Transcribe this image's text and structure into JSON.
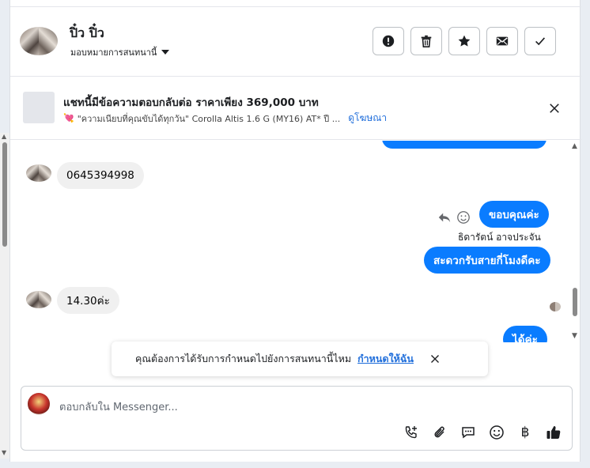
{
  "header": {
    "contact_name": "ปิ๋ว ปิ๋ว",
    "assign_label": "มอบหมายการสนทนานี้",
    "buttons": [
      "spam-icon",
      "trash-icon",
      "star-icon",
      "mail-icon",
      "check-icon"
    ]
  },
  "ad": {
    "title": "แชทนี้มีข้อความตอบกลับต่อ ราคาเพียง 369,000 บาท",
    "subtitle": "\"ความเนียบที่คุณขับได้ทุกวัน\"  Corolla Altis 1.6 G (MY16) AT* ปี ...",
    "see_ad": "ดูโฆษณา"
  },
  "messages": [
    {
      "direction": "in",
      "text": "0645394998"
    },
    {
      "direction": "out",
      "text": "ขอบคุณค่ะ"
    },
    {
      "direction": "out",
      "sender": "ธิดารัตน์ อาจประจัน",
      "text": "สะดวกรับสายกี่โมงดีคะ"
    },
    {
      "direction": "in",
      "text": "14.30ค่ะ"
    },
    {
      "direction": "out",
      "text": "ได้ค่ะ"
    }
  ],
  "toast": {
    "text": "คุณต้องการได้รับการกำหนดไปยังการสนทนานี้ไหม",
    "link": "กำหนดให้ฉัน"
  },
  "composer": {
    "placeholder": "ตอบกลับใน Messenger...",
    "tools": [
      "call-icon",
      "attach-icon",
      "saved-reply-icon",
      "emoji-icon",
      "baht-icon",
      "like-icon"
    ]
  },
  "colors": {
    "outgoing_bubble": "#0a7cff",
    "incoming_bubble": "#f0f0f0",
    "link": "#216fdb"
  }
}
